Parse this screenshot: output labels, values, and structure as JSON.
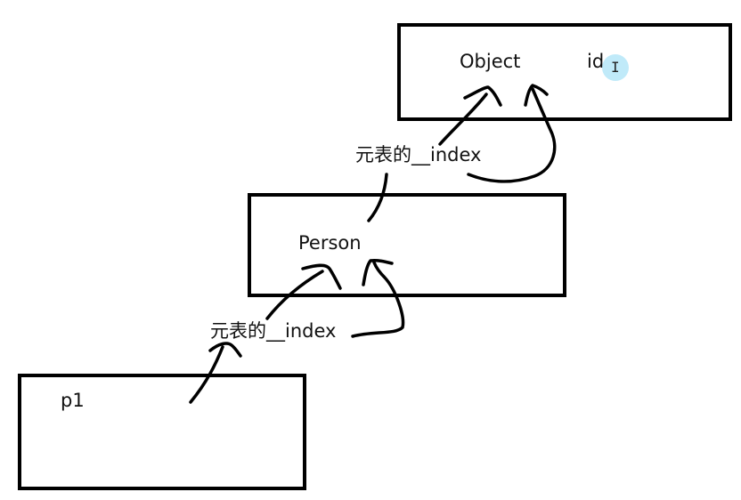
{
  "boxes": {
    "object": {
      "title": "Object",
      "field": "id"
    },
    "person": {
      "title": "Person"
    },
    "p1": {
      "title": "p1"
    }
  },
  "links": {
    "upper": {
      "label": "元表的__index"
    },
    "lower": {
      "label": "元表的__index"
    }
  },
  "colors": {
    "ink": "#000000",
    "cursor_highlight": "#96dcf5"
  },
  "cursor": {
    "icon": "text-cursor-icon",
    "glyph": "I"
  }
}
